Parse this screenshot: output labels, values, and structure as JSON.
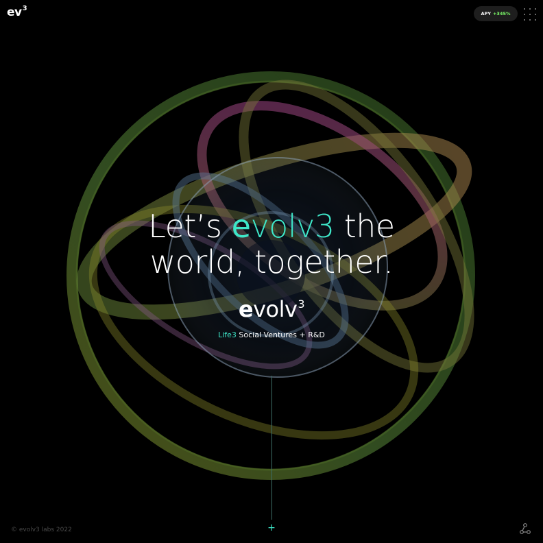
{
  "header": {
    "logo_text": "ev",
    "logo_sup": "3",
    "apy_label": "APY",
    "apy_value": "+345%",
    "menu_icon": "grid-dots-icon"
  },
  "hero": {
    "headline_part1": "Let’s ",
    "headline_brand_first": "e",
    "headline_brand_rest": "volv3",
    "headline_part2": " the",
    "headline_line2": "world, together.",
    "wordmark_bold": "e",
    "wordmark_rest": "volv",
    "wordmark_sup": "3",
    "tagline_accent": "Life3",
    "tagline_rest": " Social Ventures + R&D"
  },
  "footer": {
    "copyright": "© evolv3 labs 2022",
    "plus_symbol": "+",
    "share_icon": "share-icon"
  },
  "colors": {
    "background": "#000000",
    "accent": "#3ee6c8",
    "apy_green": "#7dff6a"
  }
}
